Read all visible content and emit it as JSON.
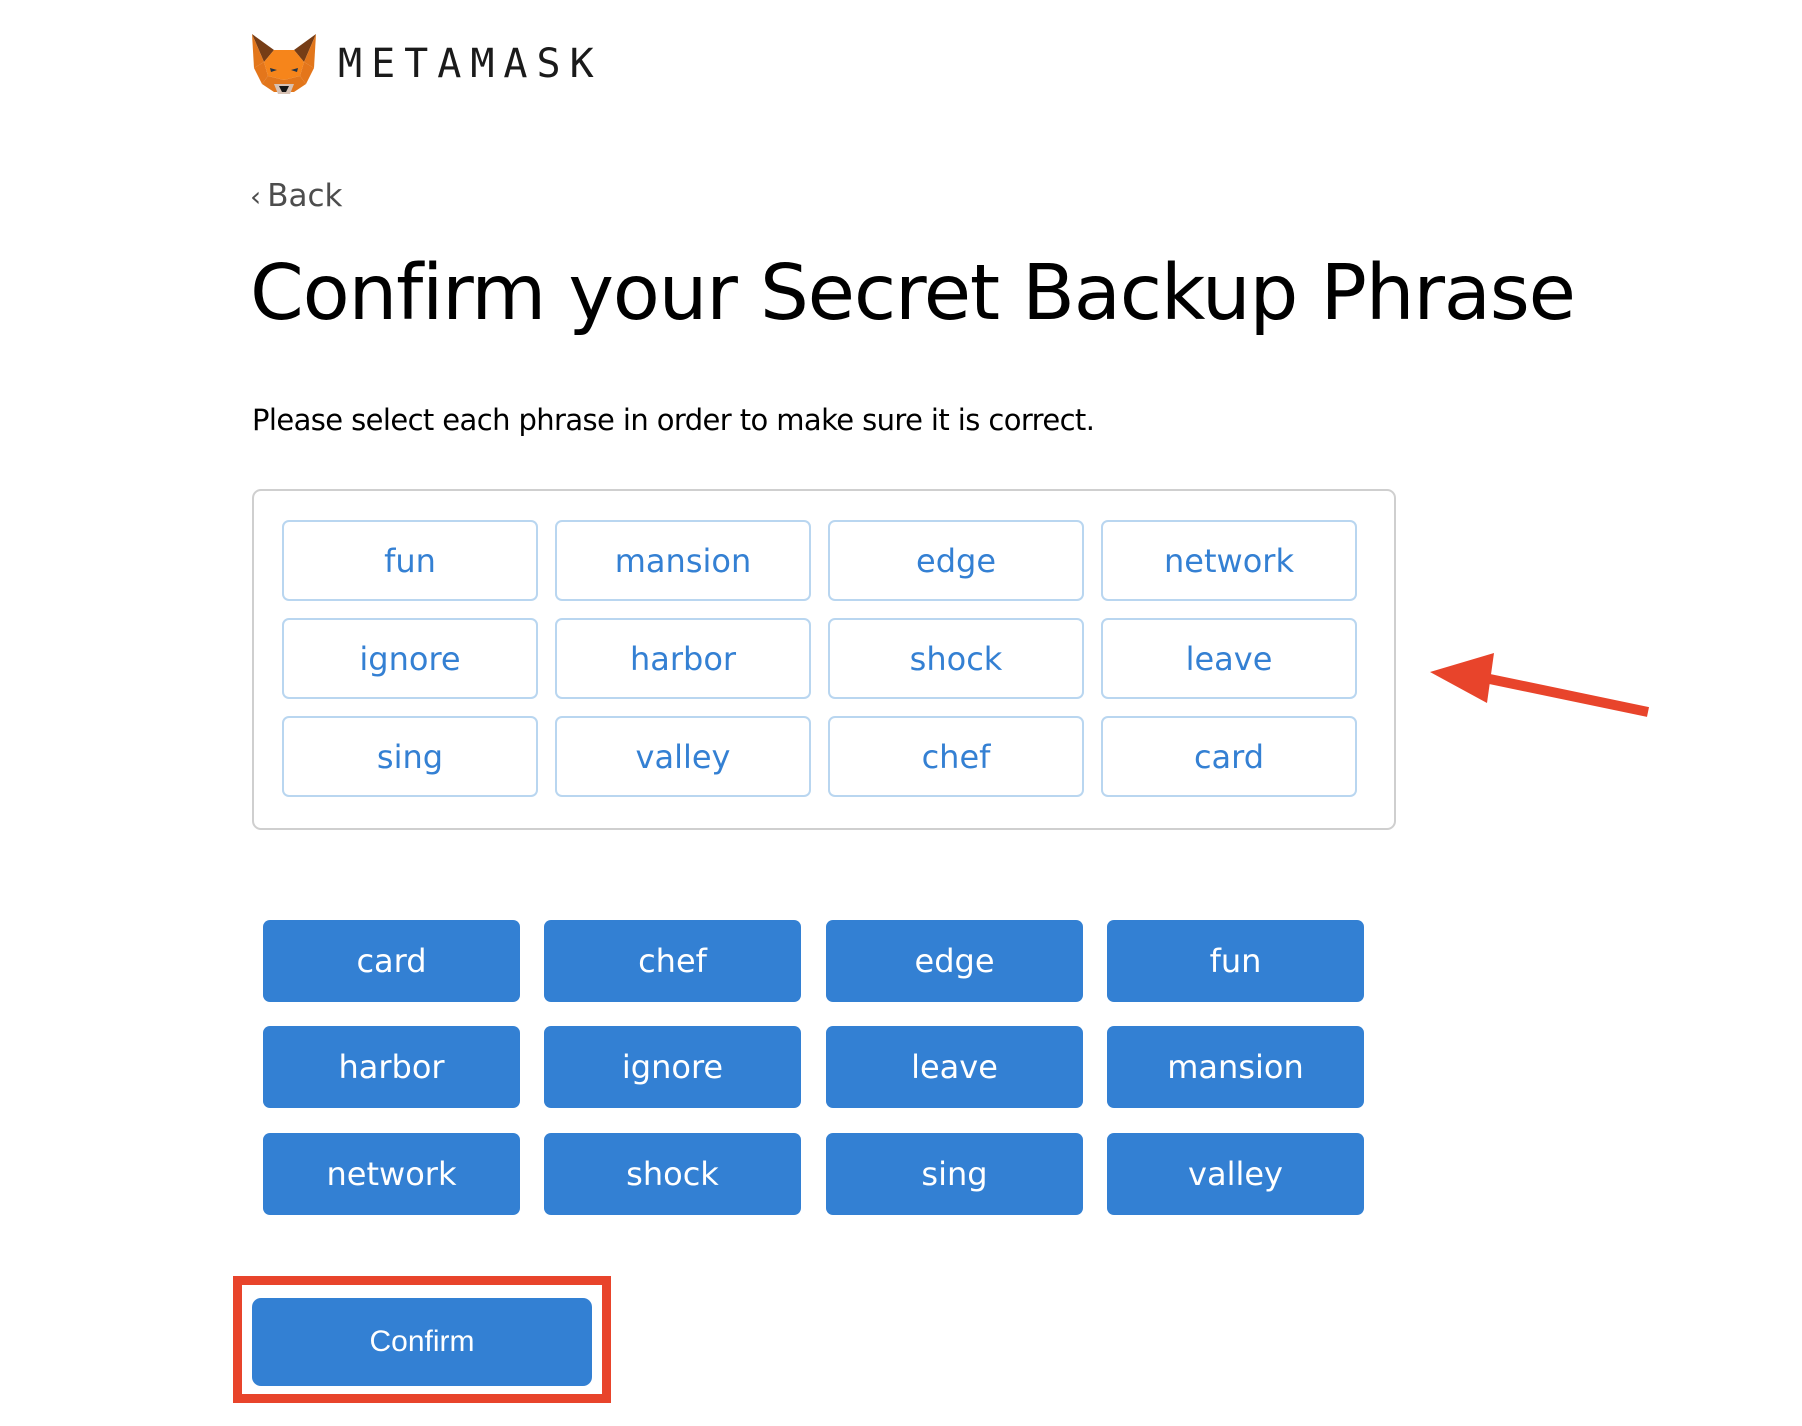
{
  "header": {
    "brand": "METAMASK",
    "logo_icon": "metamask-fox-icon"
  },
  "nav": {
    "back_label": "Back",
    "back_icon": "chevron-left-icon",
    "back_chevron": "‹"
  },
  "page": {
    "title": "Confirm your Secret Backup Phrase",
    "subtitle": "Please select each phrase in order to make sure it is correct."
  },
  "selected_words": [
    "fun",
    "mansion",
    "edge",
    "network",
    "ignore",
    "harbor",
    "shock",
    "leave",
    "sing",
    "valley",
    "chef",
    "card"
  ],
  "word_choices": [
    "card",
    "chef",
    "edge",
    "fun",
    "harbor",
    "ignore",
    "leave",
    "mansion",
    "network",
    "shock",
    "sing",
    "valley"
  ],
  "actions": {
    "confirm_label": "Confirm"
  },
  "annotations": {
    "arrow_color": "#e8442b",
    "highlight_color": "#e8442b"
  },
  "colors": {
    "primary": "#3380d3",
    "selected_border": "#b9d6f0",
    "container_border": "#cfcfcf"
  }
}
